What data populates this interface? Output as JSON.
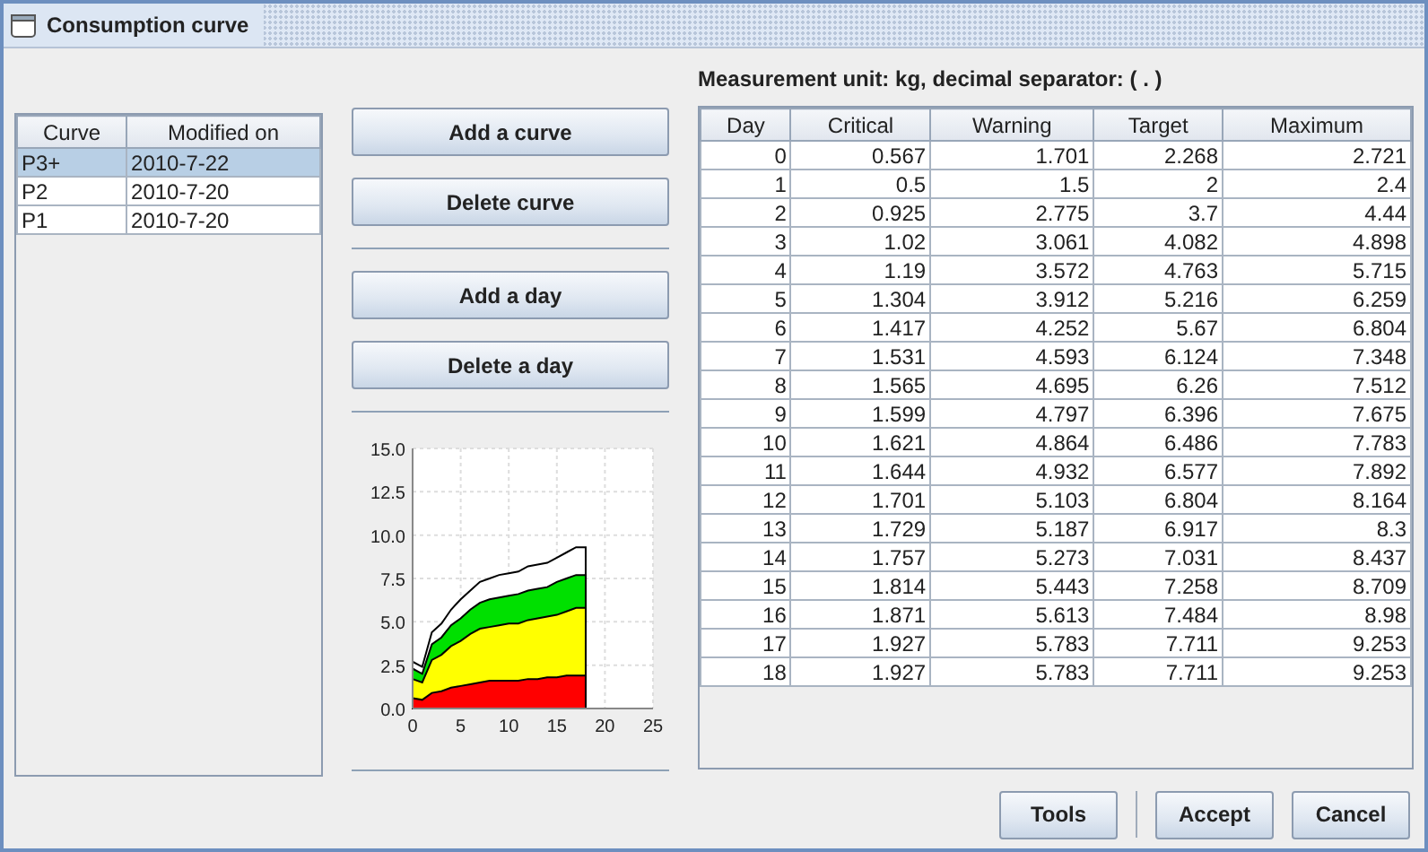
{
  "window": {
    "title": "Consumption curve"
  },
  "curves": {
    "columns": [
      "Curve",
      "Modified on"
    ],
    "rows": [
      {
        "cells": [
          "P3+",
          "2010-7-22"
        ],
        "selected": true
      },
      {
        "cells": [
          "P2",
          "2010-7-20"
        ],
        "selected": false
      },
      {
        "cells": [
          "P1",
          "2010-7-20"
        ],
        "selected": false
      }
    ]
  },
  "curve_buttons": [
    "Add a curve",
    "Delete curve"
  ],
  "day_buttons": [
    "Add a day",
    "Delete a day"
  ],
  "chart_data": {
    "type": "area",
    "stacked": false,
    "grid": true,
    "x": [
      0,
      1,
      2,
      3,
      4,
      5,
      6,
      7,
      8,
      9,
      10,
      11,
      12,
      13,
      14,
      15,
      16,
      17,
      18
    ],
    "xlim": [
      0,
      25
    ],
    "ylim": [
      0,
      15
    ],
    "xticks": [
      0,
      5,
      10,
      15,
      20,
      25
    ],
    "yticks": [
      {
        "value": 0,
        "label": "0.0"
      },
      {
        "value": 2.5,
        "label": "2.5"
      },
      {
        "value": 5,
        "label": "5.0"
      },
      {
        "value": 7.5,
        "label": "7.5"
      },
      {
        "value": 10,
        "label": "10.0"
      },
      {
        "value": 12.5,
        "label": "12.5"
      },
      {
        "value": 15,
        "label": "15.0"
      }
    ],
    "series": [
      {
        "color": "#ffffff",
        "values": [
          2.7,
          2.4,
          4.4,
          4.9,
          5.7,
          6.3,
          6.8,
          7.3,
          7.5,
          7.7,
          7.8,
          7.9,
          8.2,
          8.3,
          8.4,
          8.7,
          9.0,
          9.3,
          9.3
        ]
      },
      {
        "color": "#00e000",
        "values": [
          2.3,
          2.0,
          3.7,
          4.1,
          4.8,
          5.2,
          5.7,
          6.1,
          6.3,
          6.4,
          6.5,
          6.6,
          6.8,
          6.9,
          7.0,
          7.3,
          7.5,
          7.7,
          7.7
        ]
      },
      {
        "color": "#ffff00",
        "values": [
          1.7,
          1.5,
          2.8,
          3.1,
          3.6,
          3.9,
          4.3,
          4.6,
          4.7,
          4.8,
          4.9,
          4.9,
          5.1,
          5.2,
          5.3,
          5.4,
          5.6,
          5.8,
          5.8
        ]
      },
      {
        "color": "#ff0000",
        "values": [
          0.6,
          0.5,
          0.9,
          1.0,
          1.2,
          1.3,
          1.4,
          1.5,
          1.6,
          1.6,
          1.6,
          1.6,
          1.7,
          1.7,
          1.8,
          1.8,
          1.9,
          1.9,
          1.9
        ]
      }
    ]
  },
  "unit_label": "Measurement unit: kg, decimal separator: ( . )",
  "days": {
    "columns": [
      "Day",
      "Critical",
      "Warning",
      "Target",
      "Maximum"
    ],
    "rows": [
      [
        "0",
        "0.567",
        "1.701",
        "2.268",
        "2.721"
      ],
      [
        "1",
        "0.5",
        "1.5",
        "2",
        "2.4"
      ],
      [
        "2",
        "0.925",
        "2.775",
        "3.7",
        "4.44"
      ],
      [
        "3",
        "1.02",
        "3.061",
        "4.082",
        "4.898"
      ],
      [
        "4",
        "1.19",
        "3.572",
        "4.763",
        "5.715"
      ],
      [
        "5",
        "1.304",
        "3.912",
        "5.216",
        "6.259"
      ],
      [
        "6",
        "1.417",
        "4.252",
        "5.67",
        "6.804"
      ],
      [
        "7",
        "1.531",
        "4.593",
        "6.124",
        "7.348"
      ],
      [
        "8",
        "1.565",
        "4.695",
        "6.26",
        "7.512"
      ],
      [
        "9",
        "1.599",
        "4.797",
        "6.396",
        "7.675"
      ],
      [
        "10",
        "1.621",
        "4.864",
        "6.486",
        "7.783"
      ],
      [
        "11",
        "1.644",
        "4.932",
        "6.577",
        "7.892"
      ],
      [
        "12",
        "1.701",
        "5.103",
        "6.804",
        "8.164"
      ],
      [
        "13",
        "1.729",
        "5.187",
        "6.917",
        "8.3"
      ],
      [
        "14",
        "1.757",
        "5.273",
        "7.031",
        "8.437"
      ],
      [
        "15",
        "1.814",
        "5.443",
        "7.258",
        "8.709"
      ],
      [
        "16",
        "1.871",
        "5.613",
        "7.484",
        "8.98"
      ],
      [
        "17",
        "1.927",
        "5.783",
        "7.711",
        "9.253"
      ],
      [
        "18",
        "1.927",
        "5.783",
        "7.711",
        "9.253"
      ]
    ]
  },
  "footer_buttons": [
    "Tools",
    "Accept",
    "Cancel"
  ]
}
